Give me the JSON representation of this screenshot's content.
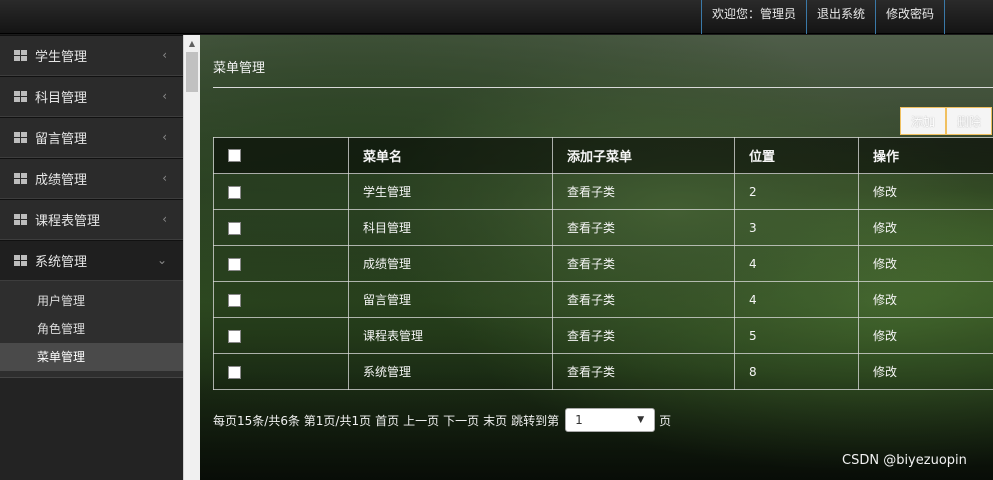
{
  "topbar": {
    "welcome": "欢迎您：管理员",
    "logout": "退出系统",
    "change_password": "修改密码"
  },
  "sidebar": {
    "items": [
      {
        "label": "学生管理",
        "arrow": "‹"
      },
      {
        "label": "科目管理",
        "arrow": "‹"
      },
      {
        "label": "留言管理",
        "arrow": "‹"
      },
      {
        "label": "成绩管理",
        "arrow": "‹"
      },
      {
        "label": "课程表管理",
        "arrow": "‹"
      },
      {
        "label": "系统管理",
        "arrow": "⌄"
      }
    ],
    "submenu": [
      {
        "label": "用户管理"
      },
      {
        "label": "角色管理"
      },
      {
        "label": "菜单管理"
      }
    ]
  },
  "main": {
    "title": "菜单管理",
    "buttons": {
      "add": "添加",
      "delete": "删除"
    },
    "table": {
      "headers": [
        "",
        "菜单名",
        "添加子菜单",
        "位置",
        "操作"
      ],
      "rows": [
        {
          "name": "学生管理",
          "sub": "查看子类",
          "pos": "2",
          "op": "修改"
        },
        {
          "name": "科目管理",
          "sub": "查看子类",
          "pos": "3",
          "op": "修改"
        },
        {
          "name": "成绩管理",
          "sub": "查看子类",
          "pos": "4",
          "op": "修改"
        },
        {
          "name": "留言管理",
          "sub": "查看子类",
          "pos": "4",
          "op": "修改"
        },
        {
          "name": "课程表管理",
          "sub": "查看子类",
          "pos": "5",
          "op": "修改"
        },
        {
          "name": "系统管理",
          "sub": "查看子类",
          "pos": "8",
          "op": "修改"
        }
      ]
    },
    "pager": {
      "summary": "每页15条/共6条 第1页/共1页",
      "first": "首页",
      "prev": "上一页",
      "next": "下一页",
      "last": "末页",
      "jump_label": "跳转到第",
      "page_value": "1",
      "page_suffix": "页"
    }
  },
  "watermark": "CSDN @biyezuopin"
}
